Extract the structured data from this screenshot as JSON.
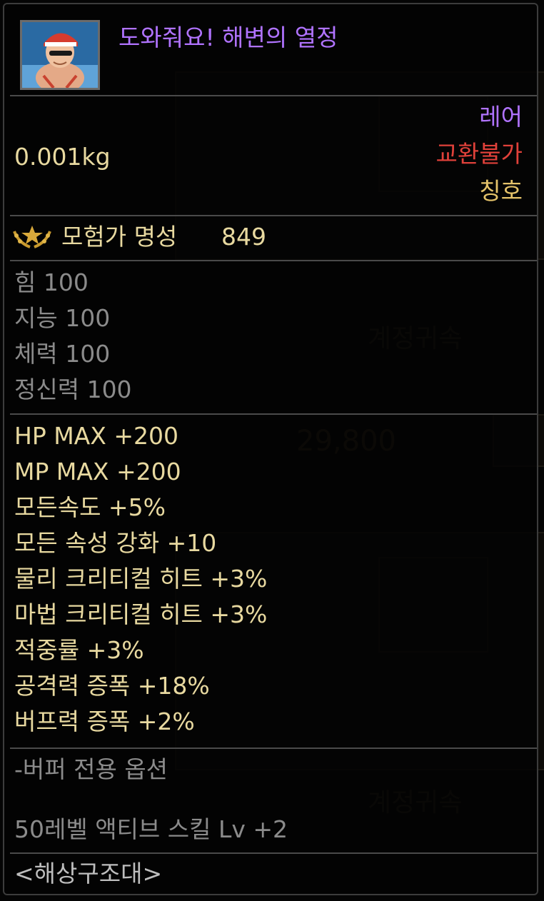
{
  "item": {
    "name": "도와줘요! 해변의 열정",
    "weight": "0.001kg",
    "rarity": "레어",
    "trade": "교환불가",
    "type": "칭호",
    "fame_label": "모험가 명성",
    "fame_value": "849"
  },
  "base_stats": [
    "힘 100",
    "지능 100",
    "체력 100",
    "정신력 100"
  ],
  "effects": [
    "HP MAX +200",
    "MP MAX +200",
    "모든속도 +5%",
    "모든 속성 강화 +10",
    "물리 크리티컬 히트 +3%",
    "마법 크리티컬 히트 +3%",
    "적중률 +3%",
    "공격력 증폭 +18%",
    "버프력 증폭 +2%"
  ],
  "buffer_options": {
    "header": "-버퍼 전용 옵션",
    "line": "50레벨 액티브 스킬 Lv +2"
  },
  "set_name": "<해상구조대>",
  "colors": {
    "rarity": "#b073ff",
    "untradeable": "#e0413a",
    "type": "#e5c36a",
    "effect_text": "#e8d9a0",
    "muted_text": "#8b8b8b"
  },
  "icons": {
    "item_icon": "lifeguard-character-icon",
    "fame_icon": "laurel-emblem-icon"
  }
}
